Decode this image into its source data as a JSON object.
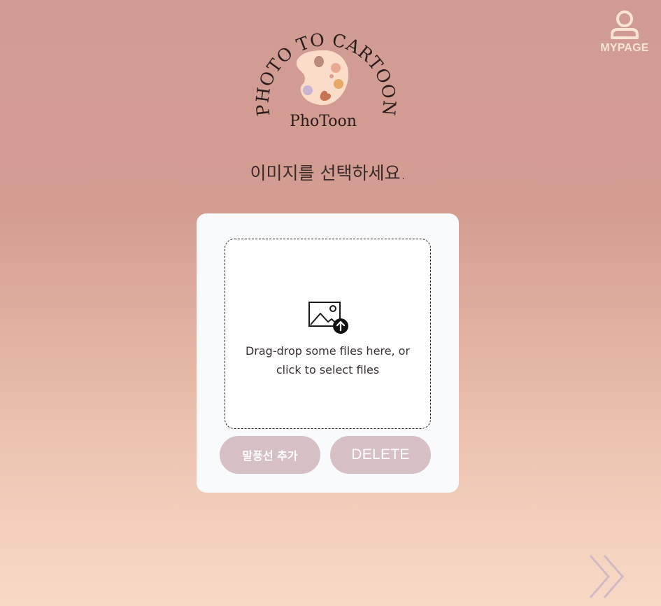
{
  "header": {
    "mypage_label": "MYPAGE",
    "mypage_icon": "user-icon"
  },
  "logo": {
    "arc_text": "PHOTO TO CARTOON",
    "brand_name": "PhoToon",
    "icon": "paint-palette-icon"
  },
  "main": {
    "instruction": "이미지를 선택하세요."
  },
  "uploader": {
    "icon": "image-upload-icon",
    "dropzone_line1": "Drag-drop some files here, or",
    "dropzone_line2": "click to select files",
    "add_bubble_label": "말풍선 추가",
    "delete_label": "DELETE"
  },
  "navigation": {
    "next_icon": "double-chevron-right-icon"
  },
  "colors": {
    "background_top": "#d09b94",
    "background_bottom": "#f8d9c6",
    "button_bg": "#d7bfc6",
    "card_bg": "#f8fafc",
    "accent_cream": "#fbe4d6"
  }
}
